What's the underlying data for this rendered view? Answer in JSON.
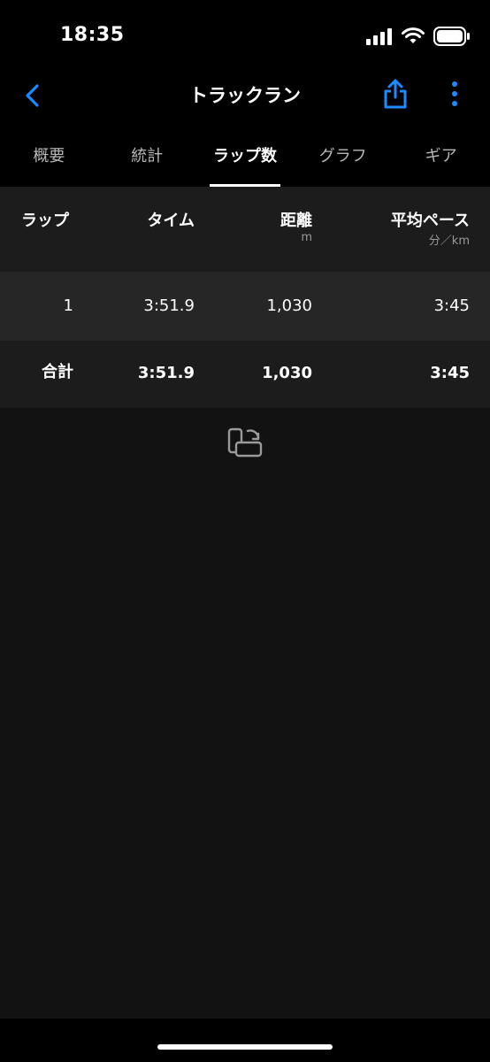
{
  "status_bar": {
    "time": "18:35"
  },
  "nav": {
    "title": "トラックラン",
    "accent_color": "#1a8cff"
  },
  "tabs": [
    {
      "label": "概要",
      "active": false
    },
    {
      "label": "統計",
      "active": false
    },
    {
      "label": "ラップ数",
      "active": true
    },
    {
      "label": "グラフ",
      "active": false
    },
    {
      "label": "ギア",
      "active": false
    }
  ],
  "table": {
    "columns": [
      {
        "label": "ラップ",
        "unit": ""
      },
      {
        "label": "タイム",
        "unit": ""
      },
      {
        "label": "距離",
        "unit": "m"
      },
      {
        "label": "平均ペース",
        "unit": "分／km"
      }
    ],
    "rows": [
      {
        "lap": "1",
        "time": "3:51.9",
        "distance": "1,030",
        "pace": "3:45"
      }
    ],
    "total": {
      "label": "合計",
      "time": "3:51.9",
      "distance": "1,030",
      "pace": "3:45"
    }
  },
  "icons": {
    "back": "chevron-left-icon",
    "share": "share-icon",
    "more": "more-vertical-icon",
    "rotate": "rotate-device-icon"
  }
}
